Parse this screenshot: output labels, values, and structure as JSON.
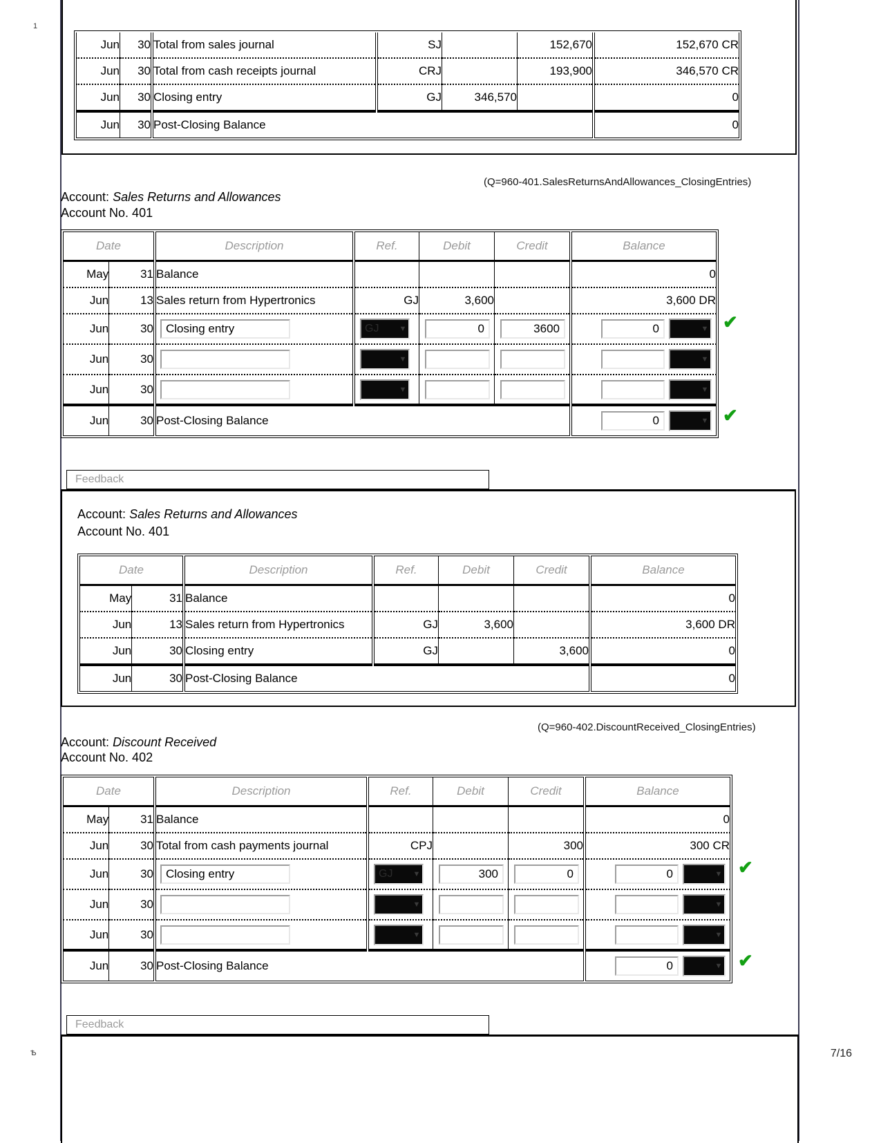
{
  "page": {
    "margin_top_number": "1",
    "margin_bottom_mark": "Ѣ",
    "page_indicator": "7/16"
  },
  "columns": {
    "date": "Date",
    "description": "Description",
    "ref": "Ref.",
    "debit": "Debit",
    "credit": "Credit",
    "balance": "Balance"
  },
  "icons": {
    "chevron_down": "▼",
    "check": "✔"
  },
  "top_table": {
    "rows": [
      {
        "mon": "Jun",
        "day": "30",
        "desc": "Total from sales journal",
        "ref": "SJ",
        "debit": "",
        "credit": "152,670",
        "balance": "152,670 CR"
      },
      {
        "mon": "Jun",
        "day": "30",
        "desc": "Total from cash receipts journal",
        "ref": "CRJ",
        "debit": "",
        "credit": "193,900",
        "balance": "346,570 CR"
      },
      {
        "mon": "Jun",
        "day": "30",
        "desc": "Closing entry",
        "ref": "GJ",
        "debit": "346,570",
        "credit": "",
        "balance": "0"
      }
    ],
    "post_closing": {
      "mon": "Jun",
      "day": "30",
      "desc": "Post-Closing Balance",
      "balance": "0"
    }
  },
  "section_401": {
    "qtag": "(Q=960-401.SalesReturnsAndAllowances_ClosingEntries)",
    "account_label": "Account:",
    "account_name": "Sales Returns and Allowances",
    "account_no_label": "Account No. 401",
    "static_rows": [
      {
        "mon": "May",
        "day": "31",
        "desc": "Balance",
        "ref": "",
        "debit": "",
        "credit": "",
        "balance": "0"
      },
      {
        "mon": "Jun",
        "day": "13",
        "desc": "Sales return from Hypertronics",
        "ref": "GJ",
        "debit": "3,600",
        "credit": "",
        "balance": "3,600 DR"
      }
    ],
    "input_rows": [
      {
        "mon": "Jun",
        "day": "30",
        "desc": "Closing entry",
        "ref_sel": "GJ",
        "debit": "0",
        "credit": "3600",
        "balance": "0",
        "bal_sel": "",
        "correct": true
      },
      {
        "mon": "Jun",
        "day": "30",
        "desc": "",
        "ref_sel": "",
        "debit": "",
        "credit": "",
        "balance": "",
        "bal_sel": "",
        "correct": false
      },
      {
        "mon": "Jun",
        "day": "30",
        "desc": "",
        "ref_sel": "",
        "debit": "",
        "credit": "",
        "balance": "",
        "bal_sel": "",
        "correct": false
      }
    ],
    "post_closing": {
      "mon": "Jun",
      "day": "30",
      "desc": "Post-Closing Balance",
      "balance": "0",
      "bal_sel": "",
      "correct": true
    },
    "feedback_label": "Feedback"
  },
  "feedback_401": {
    "account_label": "Account:",
    "account_name": "Sales Returns and Allowances",
    "account_no_label": "Account No. 401",
    "rows": [
      {
        "mon": "May",
        "day": "31",
        "desc": "Balance",
        "ref": "",
        "debit": "",
        "credit": "",
        "balance": "0"
      },
      {
        "mon": "Jun",
        "day": "13",
        "desc": "Sales return from Hypertronics",
        "ref": "GJ",
        "debit": "3,600",
        "credit": "",
        "balance": "3,600 DR"
      },
      {
        "mon": "Jun",
        "day": "30",
        "desc": "Closing entry",
        "ref": "GJ",
        "debit": "",
        "credit": "3,600",
        "balance": "0"
      }
    ],
    "post_closing": {
      "mon": "Jun",
      "day": "30",
      "desc": "Post-Closing Balance",
      "balance": "0"
    }
  },
  "section_402": {
    "qtag": "(Q=960-402.DiscountReceived_ClosingEntries)",
    "account_label": "Account:",
    "account_name": "Discount Received",
    "account_no_label": "Account No. 402",
    "static_rows": [
      {
        "mon": "May",
        "day": "31",
        "desc": "Balance",
        "ref": "",
        "debit": "",
        "credit": "",
        "balance": "0"
      },
      {
        "mon": "Jun",
        "day": "30",
        "desc": "Total from cash payments journal",
        "ref": "CPJ",
        "debit": "",
        "credit": "300",
        "balance": "300 CR"
      }
    ],
    "input_rows": [
      {
        "mon": "Jun",
        "day": "30",
        "desc": "Closing entry",
        "ref_sel": "GJ",
        "debit": "300",
        "credit": "0",
        "balance": "0",
        "bal_sel": "",
        "correct": true
      },
      {
        "mon": "Jun",
        "day": "30",
        "desc": "",
        "ref_sel": "",
        "debit": "",
        "credit": "",
        "balance": "",
        "bal_sel": "",
        "correct": false
      },
      {
        "mon": "Jun",
        "day": "30",
        "desc": "",
        "ref_sel": "",
        "debit": "",
        "credit": "",
        "balance": "",
        "bal_sel": "",
        "correct": false
      }
    ],
    "post_closing": {
      "mon": "Jun",
      "day": "30",
      "desc": "Post-Closing Balance",
      "balance": "0",
      "bal_sel": "",
      "correct": true
    },
    "feedback_label": "Feedback"
  }
}
